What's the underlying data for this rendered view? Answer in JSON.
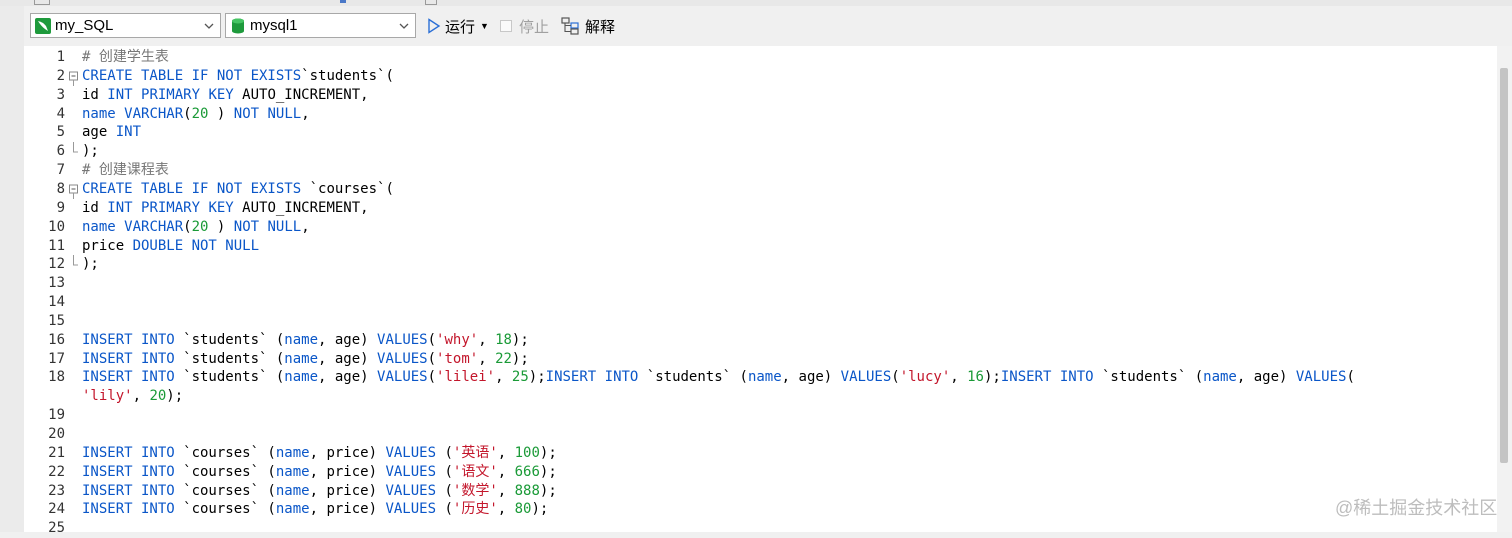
{
  "toolbar": {
    "connection": "my_SQL",
    "database": "mysql1",
    "run_label": "运行",
    "stop_label": "停止",
    "explain_label": "解释"
  },
  "editor": {
    "lines": [
      {
        "n": "1",
        "tokens": [
          [
            "cm",
            "# 创建学生表"
          ]
        ]
      },
      {
        "n": "2",
        "fold": "open",
        "tokens": [
          [
            "kw",
            "CREATE TABLE IF NOT EXISTS"
          ],
          [
            "",
            "`students`("
          ]
        ]
      },
      {
        "n": "3",
        "tokens": [
          [
            "",
            "id "
          ],
          [
            "kw",
            "INT PRIMARY KEY"
          ],
          [
            "",
            " AUTO_INCREMENT,"
          ]
        ]
      },
      {
        "n": "4",
        "tokens": [
          [
            "fn",
            "name"
          ],
          [
            "",
            " "
          ],
          [
            "kw",
            "VARCHAR"
          ],
          [
            "",
            "("
          ],
          [
            "num",
            "20"
          ],
          [
            "",
            " ) "
          ],
          [
            "kw",
            "NOT NULL"
          ],
          [
            "",
            ","
          ]
        ]
      },
      {
        "n": "5",
        "tokens": [
          [
            "",
            "age "
          ],
          [
            "kw",
            "INT"
          ]
        ]
      },
      {
        "n": "6",
        "fold": "end",
        "tokens": [
          [
            "",
            ");"
          ]
        ]
      },
      {
        "n": "7",
        "tokens": [
          [
            "cm",
            "# 创建课程表"
          ]
        ]
      },
      {
        "n": "8",
        "fold": "open",
        "tokens": [
          [
            "kw",
            "CREATE TABLE IF NOT EXISTS"
          ],
          [
            "",
            " `courses`("
          ]
        ]
      },
      {
        "n": "9",
        "tokens": [
          [
            "",
            "id "
          ],
          [
            "kw",
            "INT PRIMARY KEY"
          ],
          [
            "",
            " AUTO_INCREMENT,"
          ]
        ]
      },
      {
        "n": "10",
        "tokens": [
          [
            "fn",
            "name"
          ],
          [
            "",
            " "
          ],
          [
            "kw",
            "VARCHAR"
          ],
          [
            "",
            "("
          ],
          [
            "num",
            "20"
          ],
          [
            "",
            " ) "
          ],
          [
            "kw",
            "NOT NULL"
          ],
          [
            "",
            ","
          ]
        ]
      },
      {
        "n": "11",
        "tokens": [
          [
            "",
            "price "
          ],
          [
            "kw",
            "DOUBLE NOT NULL"
          ]
        ]
      },
      {
        "n": "12",
        "fold": "end",
        "tokens": [
          [
            "",
            ");"
          ]
        ]
      },
      {
        "n": "13",
        "tokens": []
      },
      {
        "n": "14",
        "tokens": []
      },
      {
        "n": "15",
        "tokens": []
      },
      {
        "n": "16",
        "tokens": [
          [
            "kw",
            "INSERT INTO"
          ],
          [
            "",
            " `students` ("
          ],
          [
            "fn",
            "name"
          ],
          [
            "",
            ", age) "
          ],
          [
            "kw",
            "VALUES"
          ],
          [
            "",
            "("
          ],
          [
            "str",
            "'why'"
          ],
          [
            "",
            ", "
          ],
          [
            "num",
            "18"
          ],
          [
            "",
            ");"
          ]
        ]
      },
      {
        "n": "17",
        "tokens": [
          [
            "kw",
            "INSERT INTO"
          ],
          [
            "",
            " `students` ("
          ],
          [
            "fn",
            "name"
          ],
          [
            "",
            ", age) "
          ],
          [
            "kw",
            "VALUES"
          ],
          [
            "",
            "("
          ],
          [
            "str",
            "'tom'"
          ],
          [
            "",
            ", "
          ],
          [
            "num",
            "22"
          ],
          [
            "",
            ");"
          ]
        ]
      },
      {
        "n": "18",
        "tokens": [
          [
            "kw",
            "INSERT INTO"
          ],
          [
            "",
            " `students` ("
          ],
          [
            "fn",
            "name"
          ],
          [
            "",
            ", age) "
          ],
          [
            "kw",
            "VALUES"
          ],
          [
            "",
            "("
          ],
          [
            "str",
            "'lilei'"
          ],
          [
            "",
            ", "
          ],
          [
            "num",
            "25"
          ],
          [
            "",
            ");"
          ],
          [
            "kw",
            "INSERT INTO"
          ],
          [
            "",
            " `students` ("
          ],
          [
            "fn",
            "name"
          ],
          [
            "",
            ", age) "
          ],
          [
            "kw",
            "VALUES"
          ],
          [
            "",
            "("
          ],
          [
            "str",
            "'lucy'"
          ],
          [
            "",
            ", "
          ],
          [
            "num",
            "16"
          ],
          [
            "",
            ");"
          ],
          [
            "kw",
            "INSERT INTO"
          ],
          [
            "",
            " `students` ("
          ],
          [
            "fn",
            "name"
          ],
          [
            "",
            ", age) "
          ],
          [
            "kw",
            "VALUES"
          ],
          [
            "",
            "("
          ]
        ]
      },
      {
        "n": "",
        "tokens": [
          [
            "str",
            "'lily'"
          ],
          [
            "",
            ", "
          ],
          [
            "num",
            "20"
          ],
          [
            "",
            ");"
          ]
        ]
      },
      {
        "n": "19",
        "tokens": []
      },
      {
        "n": "20",
        "tokens": []
      },
      {
        "n": "21",
        "tokens": [
          [
            "kw",
            "INSERT INTO"
          ],
          [
            "",
            " `courses` ("
          ],
          [
            "fn",
            "name"
          ],
          [
            "",
            ", price) "
          ],
          [
            "kw",
            "VALUES"
          ],
          [
            "",
            " ("
          ],
          [
            "str",
            "'英语'"
          ],
          [
            "",
            ", "
          ],
          [
            "num",
            "100"
          ],
          [
            "",
            ");"
          ]
        ]
      },
      {
        "n": "22",
        "tokens": [
          [
            "kw",
            "INSERT INTO"
          ],
          [
            "",
            " `courses` ("
          ],
          [
            "fn",
            "name"
          ],
          [
            "",
            ", price) "
          ],
          [
            "kw",
            "VALUES"
          ],
          [
            "",
            " ("
          ],
          [
            "str",
            "'语文'"
          ],
          [
            "",
            ", "
          ],
          [
            "num",
            "666"
          ],
          [
            "",
            ");"
          ]
        ]
      },
      {
        "n": "23",
        "tokens": [
          [
            "kw",
            "INSERT INTO"
          ],
          [
            "",
            " `courses` ("
          ],
          [
            "fn",
            "name"
          ],
          [
            "",
            ", price) "
          ],
          [
            "kw",
            "VALUES"
          ],
          [
            "",
            " ("
          ],
          [
            "str",
            "'数学'"
          ],
          [
            "",
            ", "
          ],
          [
            "num",
            "888"
          ],
          [
            "",
            ");"
          ]
        ]
      },
      {
        "n": "24",
        "tokens": [
          [
            "kw",
            "INSERT INTO"
          ],
          [
            "",
            " `courses` ("
          ],
          [
            "fn",
            "name"
          ],
          [
            "",
            ", price) "
          ],
          [
            "kw",
            "VALUES"
          ],
          [
            "",
            " ("
          ],
          [
            "str",
            "'历史'"
          ],
          [
            "",
            ", "
          ],
          [
            "num",
            "80"
          ],
          [
            "",
            ");"
          ]
        ]
      },
      {
        "n": "25",
        "tokens": []
      }
    ]
  },
  "watermark": "@稀土掘金技术社区"
}
